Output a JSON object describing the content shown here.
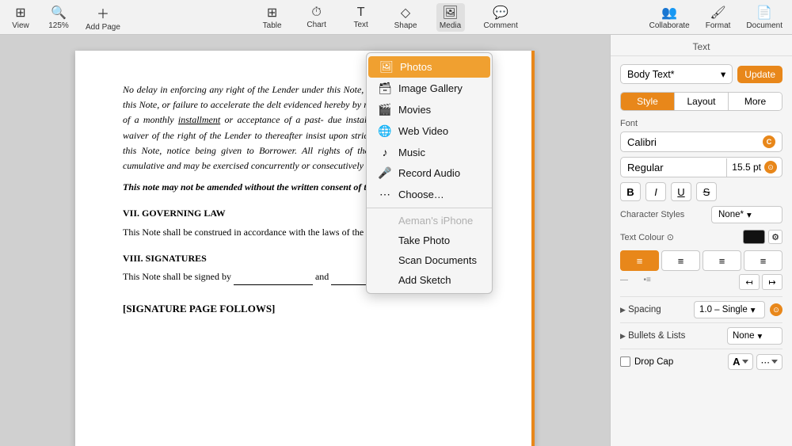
{
  "toolbar": {
    "view_label": "View",
    "zoom_label": "Zoom",
    "zoom_value": "125%",
    "add_page_label": "Add Page",
    "table_label": "Table",
    "chart_label": "Chart",
    "text_label": "Text",
    "shape_label": "Shape",
    "media_label": "Media",
    "comment_label": "Comment",
    "collaborate_label": "Collaborate",
    "format_label": "Format",
    "document_label": "Document"
  },
  "menu": {
    "items": [
      {
        "id": "photos",
        "label": "Photos",
        "icon": "🖼",
        "active": true,
        "disabled": false
      },
      {
        "id": "image-gallery",
        "label": "Image Gallery",
        "icon": "🗃",
        "active": false,
        "disabled": false
      },
      {
        "id": "movies",
        "label": "Movies",
        "icon": "🎬",
        "active": false,
        "disabled": false
      },
      {
        "id": "web-video",
        "label": "Web Video",
        "icon": "🌐",
        "active": false,
        "disabled": false
      },
      {
        "id": "music",
        "label": "Music",
        "icon": "♪",
        "active": false,
        "disabled": false
      },
      {
        "id": "record-audio",
        "label": "Record Audio",
        "icon": "🎤",
        "active": false,
        "disabled": false
      },
      {
        "id": "choose",
        "label": "Choose…",
        "icon": "⋯",
        "active": false,
        "disabled": false
      },
      {
        "id": "aemans-iphone",
        "label": "Aeman's iPhone",
        "icon": "",
        "active": false,
        "disabled": true
      },
      {
        "id": "take-photo",
        "label": "Take Photo",
        "icon": "",
        "active": false,
        "disabled": false
      },
      {
        "id": "scan-documents",
        "label": "Scan Documents",
        "icon": "",
        "active": false,
        "disabled": false
      },
      {
        "id": "add-sketch",
        "label": "Add Sketch",
        "icon": "",
        "active": false,
        "disabled": false
      }
    ]
  },
  "document": {
    "para1": "No delay in enforcing any right of the Lender under this Note, or the assignment by Lender of this Note, or failure to accelerate the debt evidenced hereby by reason of default in the payment of a monthly installment or acceptance of a past- due installment shall be construed as a waiver of the right of the Lender to thereafter insist upon strict compliance with the terms of this Note, notice being given to Borrower. All rights of the Lender under this Note are cumulative and may be exercised concurrently or consecutively at the Lender's option.",
    "bold_italic_para": "This note may not be amended without the written consent of the holder.",
    "section7_title": "VII. GOVERNING LAW",
    "section7_text": "This Note shall be construed in accordance with the laws of the State of ___________.",
    "section8_title": "VIII. SIGNATURES",
    "section8_text1": "This Note shall be signed by",
    "section8_and": "and",
    "signature_page": "[SIGNATURE PAGE FOLLOWS]"
  },
  "right_panel": {
    "header": "Text",
    "style_name": "Body Text*",
    "update_btn": "Update",
    "tabs": [
      "Style",
      "Layout",
      "More"
    ],
    "font_section": "Font",
    "font_name": "Calibri",
    "font_style": "Regular",
    "font_size": "15.5 pt",
    "format_buttons": [
      "B",
      "I",
      "U",
      "S"
    ],
    "char_styles_label": "Character Styles",
    "char_styles_value": "None*",
    "text_colour_label": "Text Colour ⊙",
    "align_buttons": [
      "≡",
      "≡",
      "≡",
      "≡"
    ],
    "spacing_label": "Spacing",
    "spacing_value": "1.0 – Single",
    "bullets_label": "Bullets & Lists",
    "bullets_value": "None",
    "drop_cap_label": "Drop Cap"
  }
}
